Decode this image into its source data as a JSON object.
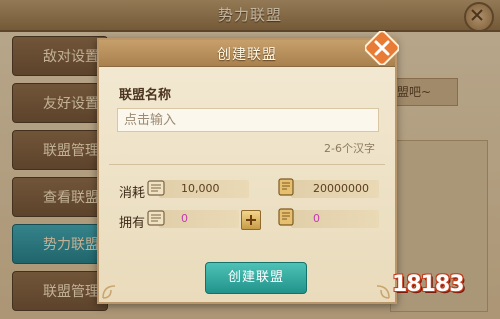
{
  "background": {
    "title": "势力联盟",
    "sidebar_items": [
      "敌对设置",
      "友好设置",
      "联盟管理",
      "查看联盟",
      "势力联盟",
      "联盟管理"
    ],
    "active_index": 4,
    "right_note": "盟吧~"
  },
  "dialog": {
    "title": "创建联盟",
    "name_label": "联盟名称",
    "name_placeholder": "点击输入",
    "hint": "2-6个汉字",
    "cost_label": "消耗",
    "owned_label": "拥有",
    "cost_silver": "10,000",
    "cost_gold": "20000000",
    "owned_silver": "0",
    "owned_gold": "0",
    "create_button": "创建联盟"
  },
  "colors": {
    "accent": "#22938a",
    "cost_text": "#5a3e1f",
    "owned_text": "#c23bb0"
  },
  "watermark": "18183"
}
